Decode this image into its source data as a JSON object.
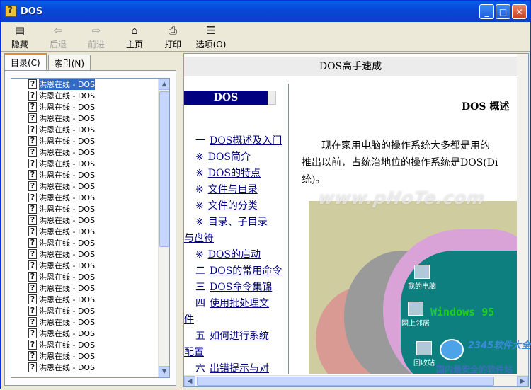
{
  "window": {
    "title": "DOS"
  },
  "toolbar": {
    "buttons": [
      {
        "label": "隐藏",
        "icon": "hide-icon",
        "enabled": true
      },
      {
        "label": "后退",
        "icon": "back-arrow-icon",
        "enabled": false
      },
      {
        "label": "前进",
        "icon": "forward-arrow-icon",
        "enabled": false
      },
      {
        "label": "主页",
        "icon": "home-icon",
        "enabled": true
      },
      {
        "label": "打印",
        "icon": "print-icon",
        "enabled": true
      },
      {
        "label": "选项(O)",
        "icon": "options-icon",
        "enabled": true
      }
    ]
  },
  "tabs": [
    {
      "label": "目录(C)",
      "active": true
    },
    {
      "label": "索引(N)",
      "active": false
    }
  ],
  "tree": {
    "items": [
      "洪恩在线 - DOS",
      "洪恩在线 - DOS",
      "洪恩在线 - DOS",
      "洪恩在线 - DOS",
      "洪恩在线 - DOS",
      "洪恩在线 - DOS",
      "洪恩在线 - DOS",
      "洪恩在线 - DOS",
      "洪恩在线 - DOS",
      "洪恩在线 - DOS",
      "洪恩在线 - DOS",
      "洪恩在线 - DOS",
      "洪恩在线 - DOS",
      "洪恩在线 - DOS",
      "洪恩在线 - DOS",
      "洪恩在线 - DOS",
      "洪恩在线 - DOS",
      "洪恩在线 - DOS",
      "洪恩在线 - DOS",
      "洪恩在线 - DOS",
      "洪恩在线 - DOS",
      "洪恩在线 - DOS",
      "洪恩在线 - DOS",
      "洪恩在线 - DOS",
      "洪恩在线 - DOS",
      "洪恩在线 - DOS"
    ],
    "selected_index": 0
  },
  "page": {
    "header": "DOS高手速成",
    "nav_title": "DOS",
    "nav_links": [
      {
        "mark": "一",
        "text": "DOS概述及入门"
      },
      {
        "mark": "※",
        "text": "DOS简介"
      },
      {
        "mark": "※",
        "text": "DOS的特点"
      },
      {
        "mark": "※",
        "text": "文件与目录"
      },
      {
        "mark": "※",
        "text": "文件的分类"
      },
      {
        "mark": "※",
        "text": "目录、子目录"
      },
      {
        "mark": "",
        "text": "与盘符",
        "wrap": true
      },
      {
        "mark": "※",
        "text": "DOS的启动"
      },
      {
        "mark": "二",
        "text": "DOS的常用命令"
      },
      {
        "mark": "三",
        "text": "DOS命令集锦"
      },
      {
        "mark": "四",
        "text": "使用批处理文"
      },
      {
        "mark": "",
        "text": "件",
        "wrap": true
      },
      {
        "mark": "五",
        "text": "如何进行系统"
      },
      {
        "mark": "",
        "text": "配置",
        "wrap": true
      },
      {
        "mark": "六",
        "text": "出错提示与对"
      }
    ],
    "content_title": "DOS 概述",
    "paragraph_lines": [
      "现在家用电脑的操作系统大多都是用的",
      "推出以前，占统治地位的操作系统是DOS(Di",
      "统)。"
    ],
    "desktop": {
      "icons": [
        "我的电脑",
        "网上邻居",
        "回收站"
      ],
      "banner": "Windows 95"
    }
  },
  "watermark": "www.pHoTe.com",
  "site_badge": {
    "brand": "2345软件大全",
    "slogan": "国内最安全的软件站"
  }
}
